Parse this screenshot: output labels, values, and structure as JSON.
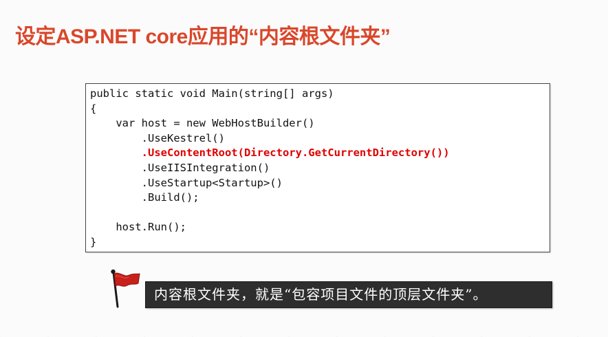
{
  "slide": {
    "title": "设定ASP.NET core应用的“内容根文件夹”"
  },
  "code": {
    "lines": [
      "public static void Main(string[] args)",
      "{",
      "    var host = new WebHostBuilder()",
      "        .UseKestrel()",
      "        .UseContentRoot(Directory.GetCurrentDirectory())",
      "        .UseIISIntegration()",
      "        .UseStartup<Startup>()",
      "        .Build();",
      "",
      "    host.Run();",
      "}"
    ],
    "highlight_line_index": 4,
    "highlight_color": "#e00000"
  },
  "callout": {
    "icon": "red-flag-icon",
    "text": "内容根文件夹，就是“包容项目文件的顶层文件夹”。"
  },
  "colors": {
    "title": "#d9472b",
    "callout_background": "#2e2e2e",
    "flag": "#c8201a"
  }
}
